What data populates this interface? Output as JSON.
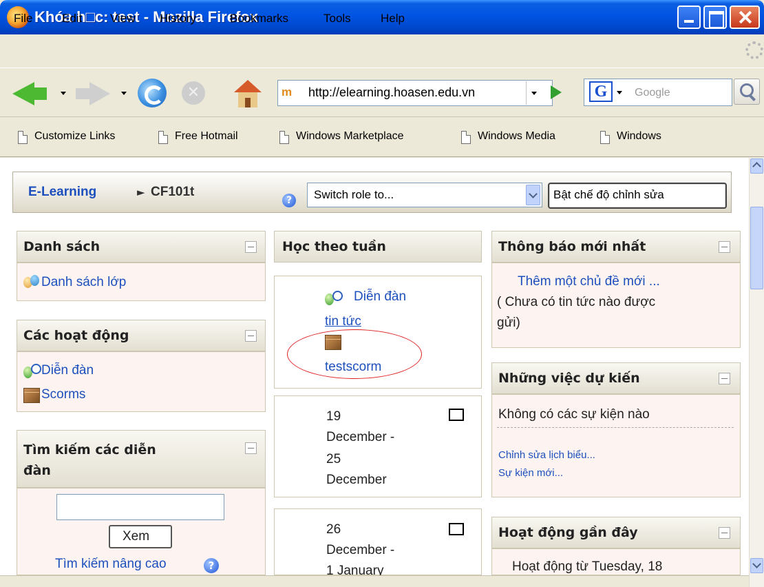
{
  "window": {
    "title": "Khóa h□c: test - Mozilla Firefox"
  },
  "menu": [
    "File",
    "Edit",
    "View",
    "History",
    "Bookmarks",
    "Tools",
    "Help"
  ],
  "navbar": {
    "url": "http://elearning.hoasen.edu.vn",
    "search_placeholder": "Google",
    "google_logo": "G"
  },
  "bookmarks": [
    "Customize Links",
    "Free Hotmail",
    "Windows Marketplace",
    "Windows Media",
    "Windows"
  ],
  "breadcrumb": {
    "home": "E-Learning",
    "arrow": "►",
    "course": "CF101t"
  },
  "role_switch": {
    "selected": "Switch role to..."
  },
  "edit_button": "Bật chế độ chỉnh sửa",
  "left_blocks": {
    "people": {
      "title": "Danh sách",
      "link": "Danh sách lớp"
    },
    "activities": {
      "title": "Các hoạt động",
      "items": [
        "Diễn đàn",
        "Scorms"
      ]
    },
    "search": {
      "title_line1": "Tìm kiếm các diễn",
      "title_line2": "đàn",
      "button": "Xem",
      "advanced": "Tìm kiếm nâng cao"
    }
  },
  "center": {
    "title": "Học theo tuần",
    "section0": {
      "forum_line1": "Diễn đàn",
      "forum_line2": "tin tức",
      "scorm": "testscorm"
    },
    "weeks": [
      {
        "l1": "19",
        "l2": "December -",
        "l3": "25",
        "l4": "December"
      },
      {
        "l1": "26",
        "l2": "December -",
        "l3": "1 January"
      }
    ]
  },
  "right_blocks": {
    "news": {
      "title": "Thông báo mới nhất",
      "add_link": "Thêm một chủ đề mới ...",
      "empty_line1": "( Chưa có tin tức nào được",
      "empty_line2": "gửi)"
    },
    "upcoming": {
      "title": "Những việc dự kiến",
      "none": "Không có các sự kiện nào",
      "edit_calendar": "Chỉnh sửa lịch biểu...",
      "new_event": "Sự kiện mới..."
    },
    "recent": {
      "title": "Hoạt động gần đây",
      "since": "Hoạt động từ Tuesday, 18"
    }
  },
  "colors": {
    "link": "#1d4fbd",
    "annotation": "#e02020",
    "block_body": "#fdf4f1"
  }
}
